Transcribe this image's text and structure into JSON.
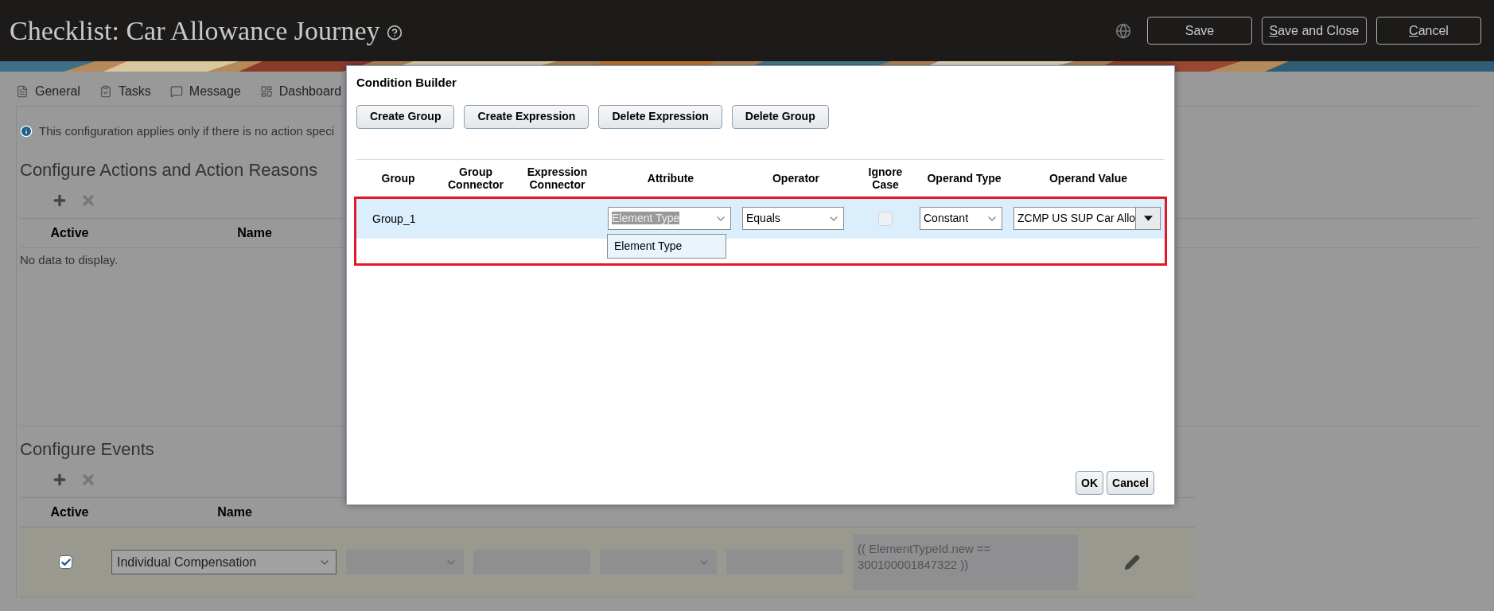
{
  "header": {
    "title": "Checklist: Car Allowance Journey",
    "buttons": [
      {
        "label": "Save",
        "underline_first": false
      },
      {
        "label": "Save and Close",
        "underline_first": true
      },
      {
        "label": "Cancel",
        "underline_first": true
      }
    ]
  },
  "tabs": [
    {
      "label": "General",
      "selected": false
    },
    {
      "label": "Tasks",
      "selected": false
    },
    {
      "label": "Message",
      "selected": false
    },
    {
      "label": "Dashboard",
      "selected": false
    }
  ],
  "info": "This configuration applies only if there is no action speci",
  "actions_section": {
    "title": "Configure Actions and Action Reasons",
    "columns": [
      "Active",
      "Name"
    ],
    "empty_text": "No data to display."
  },
  "events_section": {
    "title": "Configure Events",
    "columns": [
      "Active",
      "Name"
    ],
    "rows": [
      {
        "active": true,
        "name": "Individual Compensation",
        "condition": "(( ElementTypeId.new == 300100001847322 ))"
      }
    ]
  },
  "dialog": {
    "title": "Condition Builder",
    "buttons": [
      "Create Group",
      "Create Expression",
      "Delete Expression",
      "Delete Group"
    ],
    "columns": [
      "Group",
      "Group Connector",
      "Expression Connector",
      "Attribute",
      "Operator",
      "Ignore Case",
      "Operand Type",
      "Operand Value"
    ],
    "rows": [
      {
        "group": "Group_1",
        "attribute": "Element Type",
        "operator": "Equals",
        "ignore_case": false,
        "operand_type": "Constant",
        "operand_value": "ZCMP US SUP Car Allo",
        "selected": true
      }
    ],
    "attribute_suggestions": [
      "Element Type"
    ],
    "footer_buttons": [
      "OK",
      "Cancel"
    ]
  }
}
